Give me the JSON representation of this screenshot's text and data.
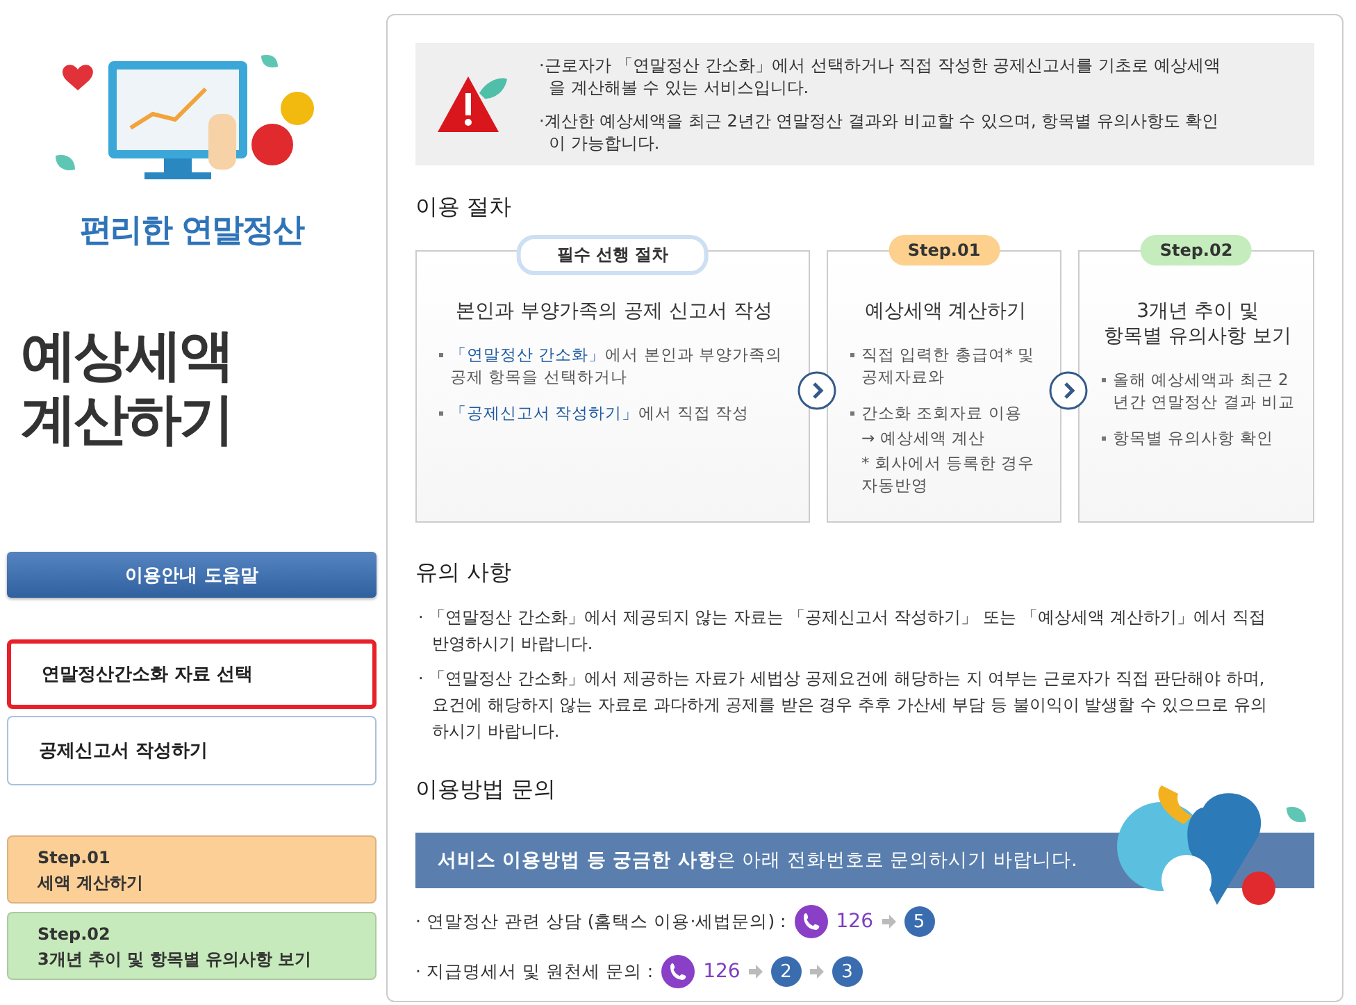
{
  "sidebar": {
    "brand": "편리한 연말정산",
    "title_lines": [
      "예상세액",
      "계산하기"
    ],
    "help_button": "이용안내 도움말",
    "menu": [
      {
        "label": "연말정산간소화 자료 선택",
        "selected": true
      },
      {
        "label": "공제신고서 작성하기",
        "selected": false
      }
    ],
    "steps": [
      {
        "step": "Step.01",
        "label": "세액 계산하기",
        "color": "#fccf96"
      },
      {
        "step": "Step.02",
        "label": "3개년 추이 및 항목별 유의사항 보기",
        "color": "#c6eabb"
      }
    ]
  },
  "notice": [
    "·근로자가 「연말정산 간소화」에서 선택하거나 직접 작성한 공제신고서를 기초로 예상세액을 계산해볼 수 있는 서비스입니다.",
    "·계산한 예상세액을 최근 2년간 연말정산 결과와 비교할 수 있으며, 항목별 유의사항도 확인이 가능합니다."
  ],
  "procedure": {
    "heading": "이용 절차",
    "cards": [
      {
        "badge": {
          "kind": "outline",
          "label": "필수 선행 절차"
        },
        "title_lines": [
          "본인과 부양가족의 공제 신고서 작성"
        ],
        "items": [
          {
            "kind": "link",
            "link": "「연말정산 간소화」",
            "text": "에서 본인과 부양가족의 공제 항목을 선택하거나"
          },
          {
            "kind": "link",
            "link": "「공제신고서 작성하기」",
            "text": "에서 직접 작성"
          }
        ]
      },
      {
        "badge": {
          "kind": "filled",
          "label": "Step.01",
          "color": "#fdd08e"
        },
        "title_lines": [
          "예상세액 계산하기"
        ],
        "items": [
          {
            "kind": "bullet",
            "text": "직접 입력한 총급여* 및 공제자료와"
          },
          {
            "kind": "bullet",
            "text": "간소화 조회자료 이용"
          },
          {
            "kind": "sub",
            "text": "→ 예상세액 계산"
          },
          {
            "kind": "note",
            "text": "* 회사에서 등록한 경우 자동반영"
          }
        ]
      },
      {
        "badge": {
          "kind": "filled",
          "label": "Step.02",
          "color": "#c4ecbc"
        },
        "title_lines": [
          "3개년 추이 및",
          "항목별 유의사항 보기"
        ],
        "items": [
          {
            "kind": "bullet",
            "text": "올해 예상세액과 최근 2년간 연말정산 결과 비교"
          },
          {
            "kind": "bullet",
            "text": "항목별 유의사항 확인"
          }
        ]
      }
    ]
  },
  "cautions": {
    "heading": "유의 사항",
    "items": [
      "· 「연말정산 간소화」에서 제공되지 않는 자료는 「공제신고서 작성하기」 또는 「예상세액 계산하기」에서 직접 반영하시기 바랍니다.",
      "· 「연말정산 간소화」에서 제공하는 자료가 세법상 공제요건에 해당하는 지 여부는 근로자가 직접 판단해야 하며, 요건에 해당하지 않는 자료로 과다하게 공제를 받은 경우 추후 가산세 부담 등 불이익이 발생할 수 있으므로 유의하시기 바랍니다."
    ]
  },
  "inquiry": {
    "heading": "이용방법 문의",
    "banner": "**서비스 이용방법 등 궁금한 사항**은 아래 전화번호로 문의하시기 바랍니다.",
    "contacts": [
      {
        "label": "· 연말정산 관련 상담 (홈택스 이용·세법문의) :",
        "number": "126",
        "keys": [
          "5"
        ]
      },
      {
        "label": "· 지급명세서  및 원천세 문의 :",
        "number": "126",
        "keys": [
          "2",
          "3"
        ]
      }
    ]
  }
}
